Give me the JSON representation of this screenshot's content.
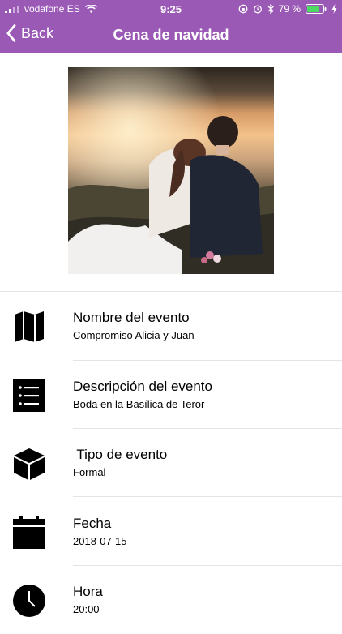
{
  "status_bar": {
    "carrier": "vodafone ES",
    "time": "9:25",
    "battery": "79 %"
  },
  "nav": {
    "back_label": "Back",
    "title": "Cena de navidad"
  },
  "event": {
    "fields": [
      {
        "label": "Nombre del evento",
        "value": "Compromiso Alicia y Juan",
        "icon": "map-icon"
      },
      {
        "label": "Descripción del evento",
        "value": "Boda en la Basílica de Teror",
        "icon": "list-icon"
      },
      {
        "label": " Tipo de evento",
        "value": "Formal",
        "icon": "cube-icon"
      },
      {
        "label": "Fecha",
        "value": "2018-07-15",
        "icon": "calendar-icon"
      },
      {
        "label": "Hora",
        "value": "20:00",
        "icon": "clock-icon"
      }
    ]
  },
  "colors": {
    "accent": "#9b59b6"
  }
}
